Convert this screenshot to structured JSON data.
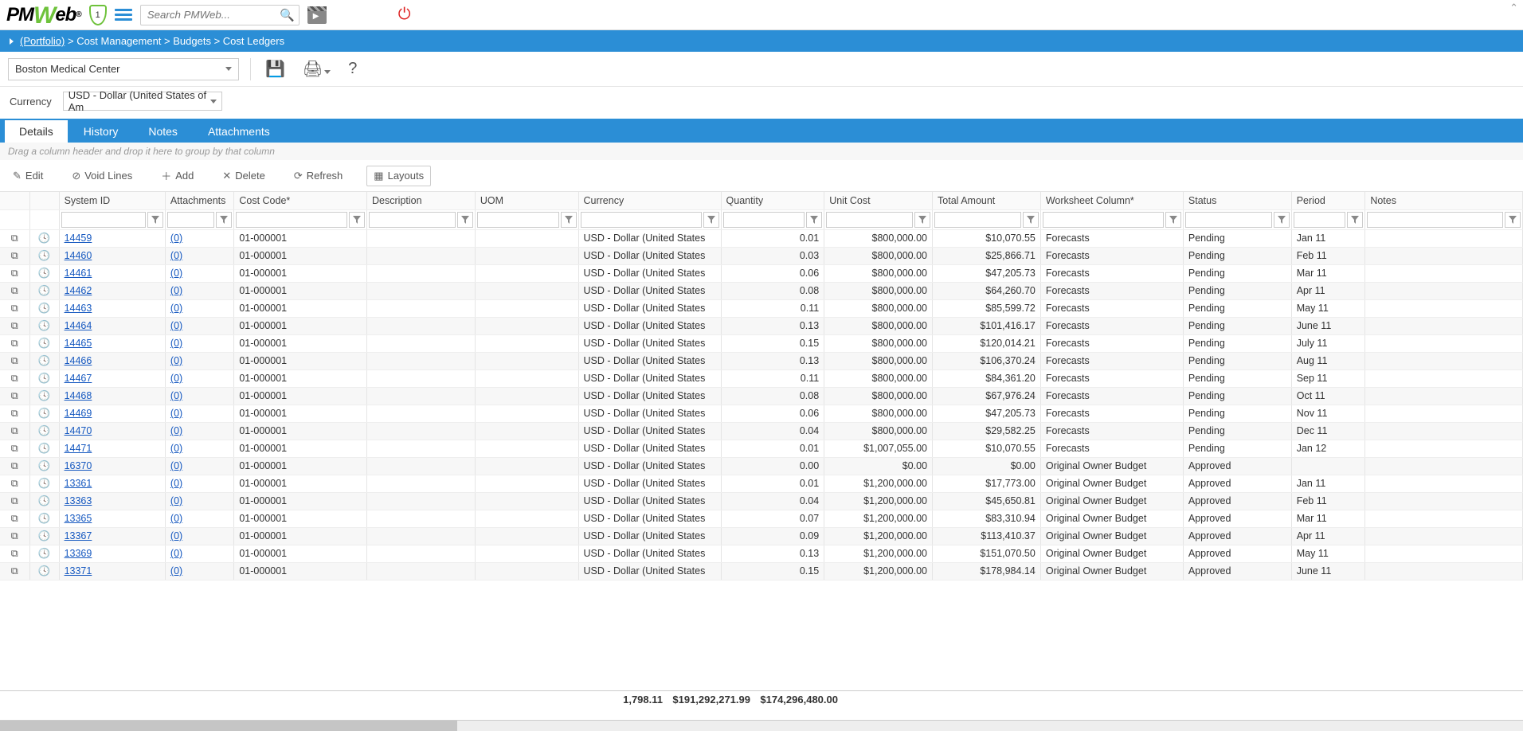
{
  "logo_text": "PMWeb",
  "shield_count": "1",
  "search_placeholder": "Search PMWeb...",
  "breadcrumb": {
    "items": [
      {
        "t": "(Portfolio)",
        "u": true
      },
      {
        "t": "Cost Management",
        "u": false
      },
      {
        "t": "Budgets",
        "u": false
      },
      {
        "t": "Cost Ledgers",
        "u": false
      }
    ]
  },
  "project_select": "Boston Medical Center",
  "currency_label": "Currency",
  "currency_value": "USD - Dollar (United States of Am",
  "tabs": [
    "Details",
    "History",
    "Notes",
    "Attachments"
  ],
  "active_tab": 0,
  "group_hint": "Drag a column header and drop it here to group by that column",
  "actions": {
    "edit": "Edit",
    "void": "Void Lines",
    "add": "Add",
    "delete": "Delete",
    "refresh": "Refresh",
    "layouts": "Layouts"
  },
  "columns": [
    "System ID",
    "Attachments",
    "Cost Code*",
    "Description",
    "UOM",
    "Currency",
    "Quantity",
    "Unit Cost",
    "Total Amount",
    "Worksheet Column*",
    "Status",
    "Period",
    "Notes"
  ],
  "rows": [
    {
      "sys": "14459",
      "att": "(0)",
      "cc": "01-000001",
      "cur": "USD - Dollar (United States",
      "qty": "0.01",
      "uc": "$800,000.00",
      "tot": "$10,070.55",
      "wsc": "Forecasts",
      "stat": "Pending",
      "per": "Jan 11"
    },
    {
      "sys": "14460",
      "att": "(0)",
      "cc": "01-000001",
      "cur": "USD - Dollar (United States",
      "qty": "0.03",
      "uc": "$800,000.00",
      "tot": "$25,866.71",
      "wsc": "Forecasts",
      "stat": "Pending",
      "per": "Feb 11"
    },
    {
      "sys": "14461",
      "att": "(0)",
      "cc": "01-000001",
      "cur": "USD - Dollar (United States",
      "qty": "0.06",
      "uc": "$800,000.00",
      "tot": "$47,205.73",
      "wsc": "Forecasts",
      "stat": "Pending",
      "per": "Mar 11"
    },
    {
      "sys": "14462",
      "att": "(0)",
      "cc": "01-000001",
      "cur": "USD - Dollar (United States",
      "qty": "0.08",
      "uc": "$800,000.00",
      "tot": "$64,260.70",
      "wsc": "Forecasts",
      "stat": "Pending",
      "per": "Apr 11"
    },
    {
      "sys": "14463",
      "att": "(0)",
      "cc": "01-000001",
      "cur": "USD - Dollar (United States",
      "qty": "0.11",
      "uc": "$800,000.00",
      "tot": "$85,599.72",
      "wsc": "Forecasts",
      "stat": "Pending",
      "per": "May 11"
    },
    {
      "sys": "14464",
      "att": "(0)",
      "cc": "01-000001",
      "cur": "USD - Dollar (United States",
      "qty": "0.13",
      "uc": "$800,000.00",
      "tot": "$101,416.17",
      "wsc": "Forecasts",
      "stat": "Pending",
      "per": "June 11"
    },
    {
      "sys": "14465",
      "att": "(0)",
      "cc": "01-000001",
      "cur": "USD - Dollar (United States",
      "qty": "0.15",
      "uc": "$800,000.00",
      "tot": "$120,014.21",
      "wsc": "Forecasts",
      "stat": "Pending",
      "per": "July 11"
    },
    {
      "sys": "14466",
      "att": "(0)",
      "cc": "01-000001",
      "cur": "USD - Dollar (United States",
      "qty": "0.13",
      "uc": "$800,000.00",
      "tot": "$106,370.24",
      "wsc": "Forecasts",
      "stat": "Pending",
      "per": "Aug 11"
    },
    {
      "sys": "14467",
      "att": "(0)",
      "cc": "01-000001",
      "cur": "USD - Dollar (United States",
      "qty": "0.11",
      "uc": "$800,000.00",
      "tot": "$84,361.20",
      "wsc": "Forecasts",
      "stat": "Pending",
      "per": "Sep 11"
    },
    {
      "sys": "14468",
      "att": "(0)",
      "cc": "01-000001",
      "cur": "USD - Dollar (United States",
      "qty": "0.08",
      "uc": "$800,000.00",
      "tot": "$67,976.24",
      "wsc": "Forecasts",
      "stat": "Pending",
      "per": "Oct 11"
    },
    {
      "sys": "14469",
      "att": "(0)",
      "cc": "01-000001",
      "cur": "USD - Dollar (United States",
      "qty": "0.06",
      "uc": "$800,000.00",
      "tot": "$47,205.73",
      "wsc": "Forecasts",
      "stat": "Pending",
      "per": "Nov 11"
    },
    {
      "sys": "14470",
      "att": "(0)",
      "cc": "01-000001",
      "cur": "USD - Dollar (United States",
      "qty": "0.04",
      "uc": "$800,000.00",
      "tot": "$29,582.25",
      "wsc": "Forecasts",
      "stat": "Pending",
      "per": "Dec 11"
    },
    {
      "sys": "14471",
      "att": "(0)",
      "cc": "01-000001",
      "cur": "USD - Dollar (United States",
      "qty": "0.01",
      "uc": "$1,007,055.00",
      "tot": "$10,070.55",
      "wsc": "Forecasts",
      "stat": "Pending",
      "per": "Jan 12"
    },
    {
      "sys": "16370",
      "att": "(0)",
      "cc": "01-000001",
      "cur": "USD - Dollar (United States",
      "qty": "0.00",
      "uc": "$0.00",
      "tot": "$0.00",
      "wsc": "Original Owner Budget",
      "stat": "Approved",
      "per": ""
    },
    {
      "sys": "13361",
      "att": "(0)",
      "cc": "01-000001",
      "cur": "USD - Dollar (United States",
      "qty": "0.01",
      "uc": "$1,200,000.00",
      "tot": "$17,773.00",
      "wsc": "Original Owner Budget",
      "stat": "Approved",
      "per": "Jan 11"
    },
    {
      "sys": "13363",
      "att": "(0)",
      "cc": "01-000001",
      "cur": "USD - Dollar (United States",
      "qty": "0.04",
      "uc": "$1,200,000.00",
      "tot": "$45,650.81",
      "wsc": "Original Owner Budget",
      "stat": "Approved",
      "per": "Feb 11"
    },
    {
      "sys": "13365",
      "att": "(0)",
      "cc": "01-000001",
      "cur": "USD - Dollar (United States",
      "qty": "0.07",
      "uc": "$1,200,000.00",
      "tot": "$83,310.94",
      "wsc": "Original Owner Budget",
      "stat": "Approved",
      "per": "Mar 11"
    },
    {
      "sys": "13367",
      "att": "(0)",
      "cc": "01-000001",
      "cur": "USD - Dollar (United States",
      "qty": "0.09",
      "uc": "$1,200,000.00",
      "tot": "$113,410.37",
      "wsc": "Original Owner Budget",
      "stat": "Approved",
      "per": "Apr 11"
    },
    {
      "sys": "13369",
      "att": "(0)",
      "cc": "01-000001",
      "cur": "USD - Dollar (United States",
      "qty": "0.13",
      "uc": "$1,200,000.00",
      "tot": "$151,070.50",
      "wsc": "Original Owner Budget",
      "stat": "Approved",
      "per": "May 11"
    },
    {
      "sys": "13371",
      "att": "(0)",
      "cc": "01-000001",
      "cur": "USD - Dollar (United States",
      "qty": "0.15",
      "uc": "$1,200,000.00",
      "tot": "$178,984.14",
      "wsc": "Original Owner Budget",
      "stat": "Approved",
      "per": "June 11"
    }
  ],
  "totals": {
    "qty": "1,798.11",
    "uc": "$191,292,271.99",
    "tot": "$174,296,480.00"
  }
}
